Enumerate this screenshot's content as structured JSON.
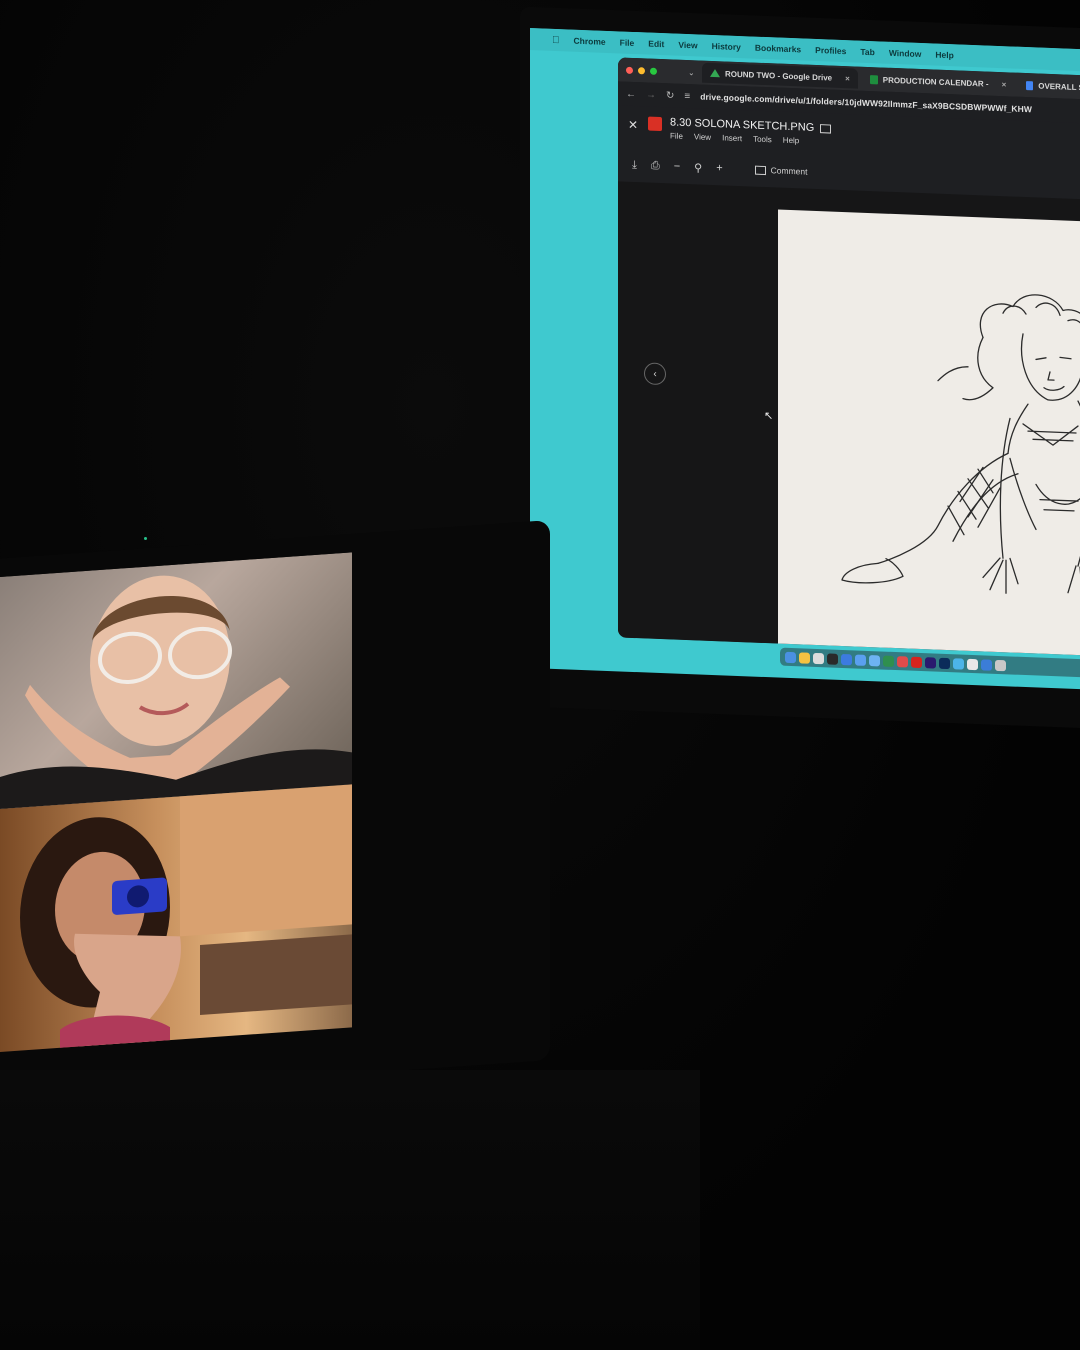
{
  "menubar": {
    "items": [
      "Chrome",
      "File",
      "Edit",
      "View",
      "History",
      "Bookmarks",
      "Profiles",
      "Tab",
      "Window",
      "Help"
    ]
  },
  "browser": {
    "tabs": [
      {
        "label": "ROUND TWO - Google Drive",
        "icon": "google-drive-icon"
      },
      {
        "label": "PRODUCTION CALENDAR -",
        "icon": "google-sheets-icon"
      },
      {
        "label": "OVERALL S",
        "icon": "google-docs-icon"
      }
    ],
    "url": "drive.google.com/drive/u/1/folders/10jdWW92IlmmzF_saX9BCSDBWPWWf_KHW"
  },
  "viewer": {
    "file_name": "8.30 SOLONA SKETCH.PNG",
    "menu": [
      "File",
      "View",
      "Insert",
      "Tools",
      "Help"
    ],
    "comment_label": "Comment"
  },
  "colors": {
    "desktop_wallpaper": "#3fc9cf",
    "viewer_background": "#161617",
    "sketch_paper": "#efece7"
  }
}
